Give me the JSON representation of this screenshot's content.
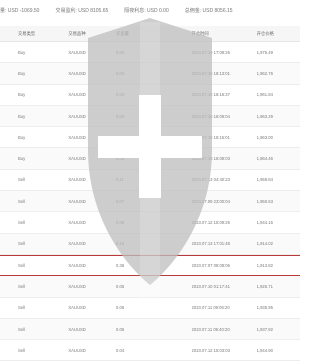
{
  "summary": {
    "items": [
      "量: USD -1069.50",
      "交易盈利: USD 8105.65",
      "隔夜利息: USD 0.00",
      "总佣金: USD 8056.15"
    ]
  },
  "table": {
    "headers": [
      "交易类型",
      "交易品种",
      "买卖量",
      "",
      "开仓时间",
      "开仓价格"
    ],
    "rows": [
      [
        "Buy",
        "XAUUSD",
        "0.04",
        "",
        "2023.07.19 17:08:26",
        "1,975.49"
      ],
      [
        "Buy",
        "XAUUSD",
        "0.03",
        "",
        "2023.07.18 16:13:01",
        "1,962.76"
      ],
      [
        "Buy",
        "XAUUSD",
        "0.03",
        "",
        "2023.07.18 16:16:37",
        "1,961.84"
      ],
      [
        "Buy",
        "XAUUSD",
        "0.03",
        "",
        "2023.07.18 16:09:04",
        "1,963.29"
      ],
      [
        "Buy",
        "XAUUSD",
        "0.03",
        "",
        "2023.07.18 16:15:01",
        "1,963.00"
      ],
      [
        "Buy",
        "XAUUSD",
        "0.05",
        "",
        "2023.07.18 16:08:03",
        "1,964.46"
      ],
      [
        "Sell",
        "XAUUSD",
        "0.11",
        "",
        "2023.07.13 04:40:23",
        "1,959.84"
      ],
      [
        "Sell",
        "XAUUSD",
        "0.07",
        "",
        "2023.07.09 23:00:04",
        "1,950.63"
      ],
      [
        "Sell",
        "XAUUSD",
        "0.08",
        "",
        "2023.07.12 15:09:26",
        "1,944.15"
      ],
      [
        "Sell",
        "XAUUSD",
        "0.16",
        "",
        "2023.07.13 17:01:48",
        "1,914.02"
      ],
      [
        "Sell",
        "XAUUSD",
        "0.36",
        "",
        "2023.07.07 08:08:06",
        "1,913.82"
      ],
      [
        "Sell",
        "XAUUSD",
        "0.05",
        "",
        "2023.07.10 01:17:41",
        "1,925.71"
      ],
      [
        "Sell",
        "XAUUSD",
        "0.06",
        "",
        "2023.07.11 09:06:20",
        "1,935.95"
      ],
      [
        "Sell",
        "XAUUSD",
        "0.05",
        "",
        "2023.07.11 09:40:20",
        "1,937.92"
      ],
      [
        "Sell",
        "XAUUSD",
        "0.04",
        "",
        "2023.07.12 15:03:03",
        "1,944.90"
      ]
    ],
    "highlighted_row": 10
  },
  "colors": {
    "watermark": "#bdbdbd",
    "highlight_border": "#b93a3a"
  },
  "icons": [
    "shield-watermark-icon"
  ]
}
